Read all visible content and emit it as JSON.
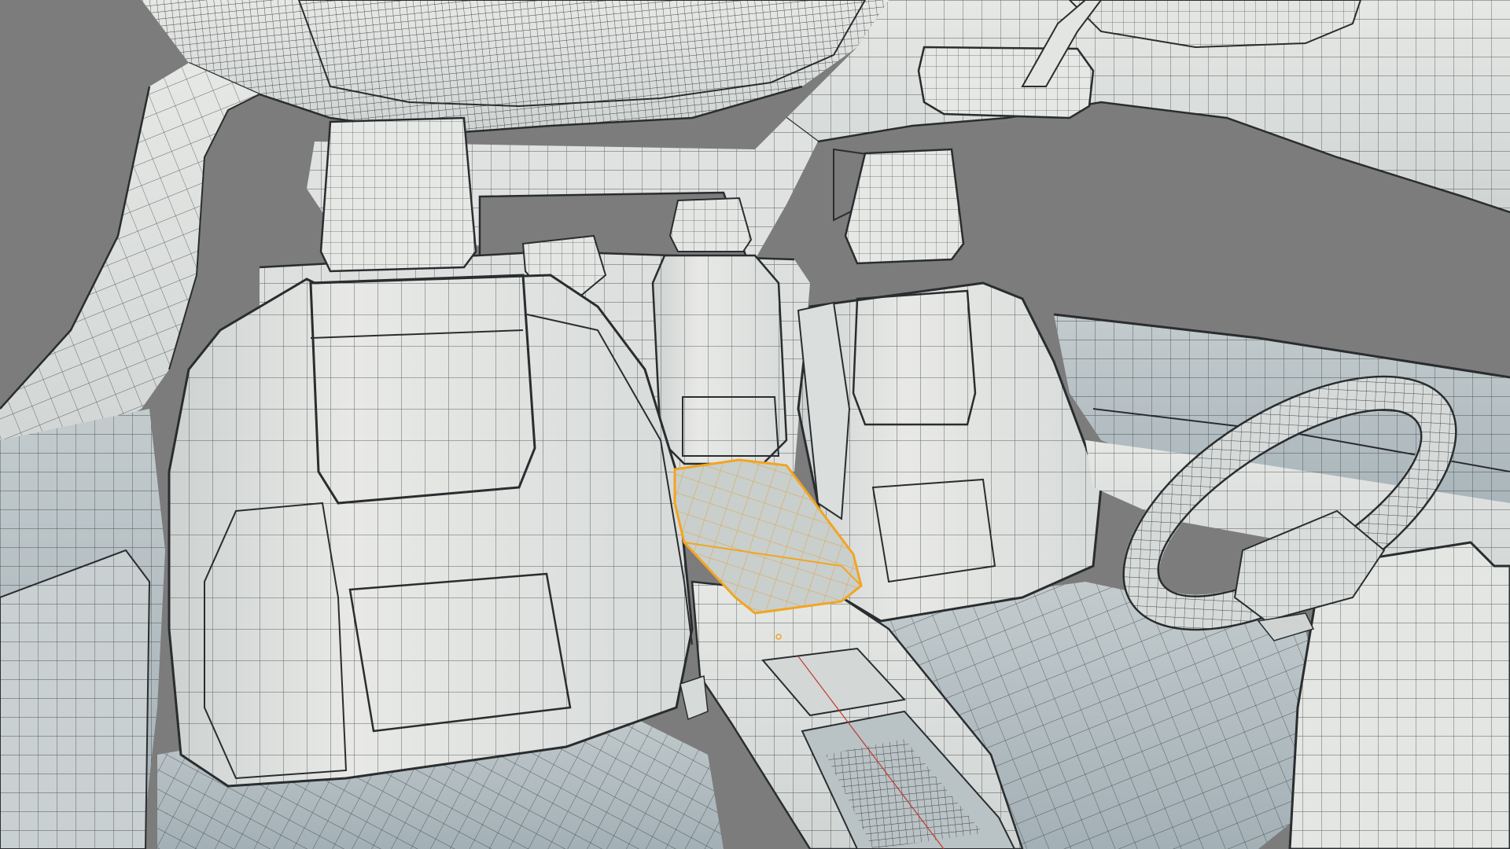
{
  "viewport": {
    "background": "#7c7c7c",
    "surface_color": "#e3e5e2",
    "surface_shade": "#c2c8c8",
    "blue_shade": "#9aa8b0",
    "wire_color": "#2a2d2f",
    "selection_color": "#f2a520",
    "selected_fill": "#c9cfcd"
  },
  "scene": {
    "subject": "vehicle-interior-wireframe",
    "selected_object": "center-armrest",
    "visible_objects": [
      "headliner",
      "rearview-mirror",
      "sun-visor",
      "a-pillar",
      "left-front-seat",
      "right-front-seat",
      "rear-bench-seat",
      "center-armrest",
      "center-console",
      "steering-wheel",
      "dashboard",
      "door-panel-left",
      "door-panel-right",
      "floor"
    ]
  }
}
